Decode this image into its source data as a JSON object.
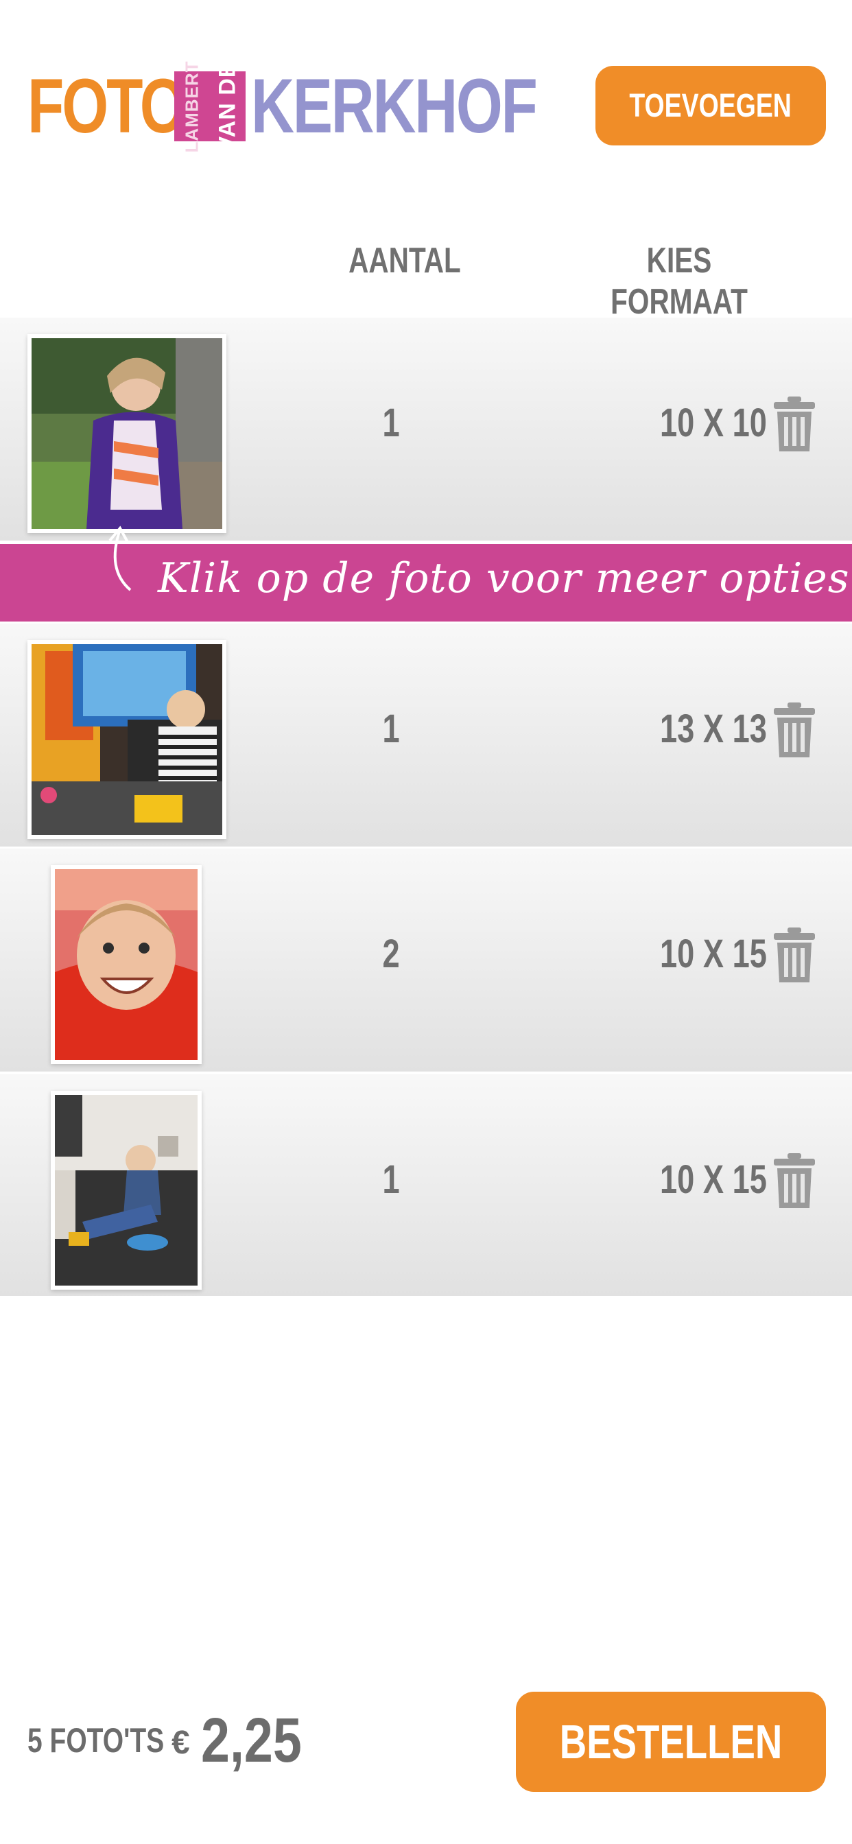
{
  "header": {
    "logo": {
      "word1": "FOTO",
      "line_small": "LAMBERT",
      "line_big": "VAN DE",
      "word2": "KERKHOF"
    },
    "add_button": "TOEVOEGEN"
  },
  "columns": {
    "quantity": "AANTAL",
    "format": "KIES FORMAAT"
  },
  "rows": [
    {
      "quantity": "1",
      "format": "10 X 10"
    },
    {
      "quantity": "1",
      "format": "13 X 13"
    },
    {
      "quantity": "2",
      "format": "10 X 15"
    },
    {
      "quantity": "1",
      "format": "10 X 15"
    }
  ],
  "tip": "Klik op de foto voor meer opties",
  "footer": {
    "count": "5 FOTO'TS",
    "currency": "€",
    "total": "2,25",
    "order_button": "BESTELLEN"
  },
  "colors": {
    "orange": "#f08d28",
    "pink": "#cb4592",
    "lavender": "#9494ce",
    "text": "#6f6f6f"
  },
  "icons": {
    "delete": "trash-icon",
    "hint": "curved-arrow-icon"
  }
}
